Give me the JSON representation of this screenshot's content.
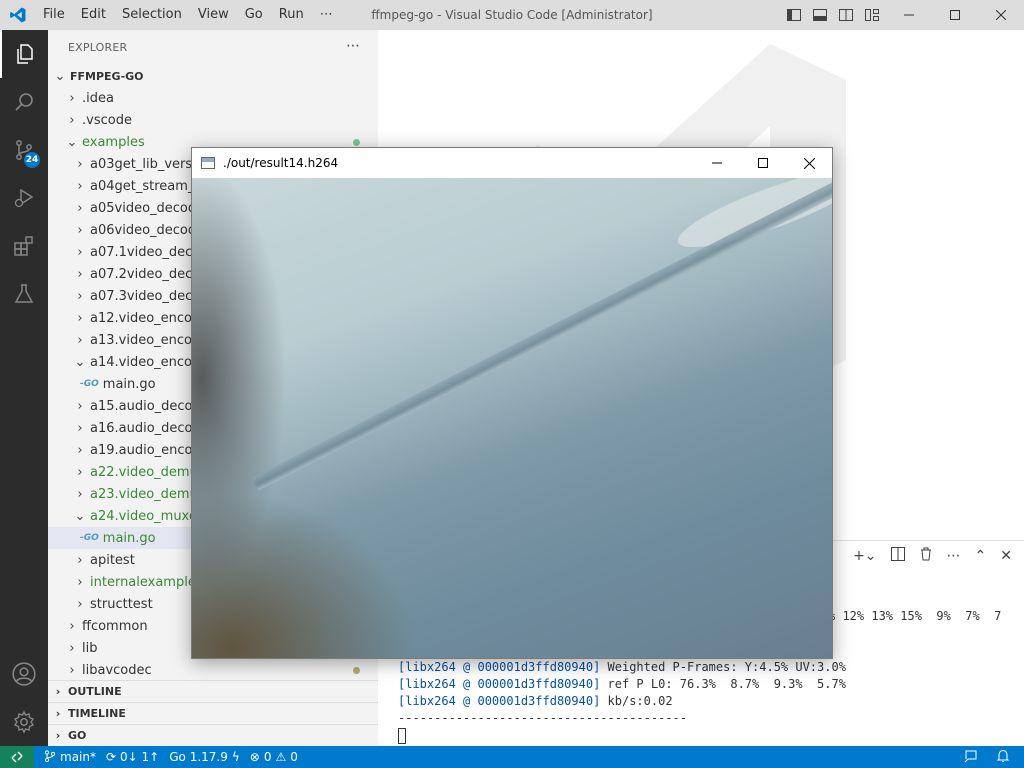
{
  "titlebar": {
    "menu": [
      "File",
      "Edit",
      "Selection",
      "View",
      "Go",
      "Run",
      "⋯"
    ],
    "title": "ffmpeg-go - Visual Studio Code [Administrator]"
  },
  "activitybar": {
    "scm_badge": "24"
  },
  "sidebar": {
    "header": "EXPLORER",
    "more": "⋯",
    "root": "FFMPEG-GO",
    "items": [
      {
        "label": ".idea"
      },
      {
        "label": ".vscode"
      },
      {
        "label": "examples"
      },
      {
        "label": "a03get_lib_version"
      },
      {
        "label": "a04get_stream_inf"
      },
      {
        "label": "a05video_decode_"
      },
      {
        "label": "a06video_decode_"
      },
      {
        "label": "a07.1video_decod"
      },
      {
        "label": "a07.2video_decod"
      },
      {
        "label": "a07.3video_decod"
      },
      {
        "label": "a12.video_encode"
      },
      {
        "label": "a13.video_encode"
      },
      {
        "label": "a14.video_encode"
      },
      {
        "label": "main.go"
      },
      {
        "label": "a15.audio_decode"
      },
      {
        "label": "a16.audio_decode"
      },
      {
        "label": "a19.audio_encode"
      },
      {
        "label": "a22.video_demuxe"
      },
      {
        "label": "a23.video_demuxe"
      },
      {
        "label": "a24.video_muxer_"
      },
      {
        "label": "main.go"
      },
      {
        "label": "apitest"
      },
      {
        "label": "internalexamples"
      },
      {
        "label": "structtest"
      },
      {
        "label": "ffcommon"
      },
      {
        "label": "lib"
      },
      {
        "label": "libavcodec"
      }
    ],
    "sections": [
      "OUTLINE",
      "TIMELINE",
      "GO"
    ]
  },
  "popup": {
    "title": "./out/result14.h264"
  },
  "terminal": {
    "partial_line": "% 12% 13% 15%  9%  7%  7",
    "lines": [
      {
        "lib": "[libx264 @ 000001d3ffd80940]",
        "text": " Weighted P-Frames: Y:4.5% UV:3.0%"
      },
      {
        "lib": "[libx264 @ 000001d3ffd80940]",
        "text": " ref P L0: 76.3%  8.7%  9.3%  5.7%"
      },
      {
        "lib": "[libx264 @ 000001d3ffd80940]",
        "text": " kb/s:0.02"
      }
    ],
    "separator": "----------------------------------------"
  },
  "statusbar": {
    "branch": "main*",
    "sync": "0↓ 1↑",
    "go_version": "Go 1.17.9",
    "errors": "0",
    "warnings": "0"
  }
}
